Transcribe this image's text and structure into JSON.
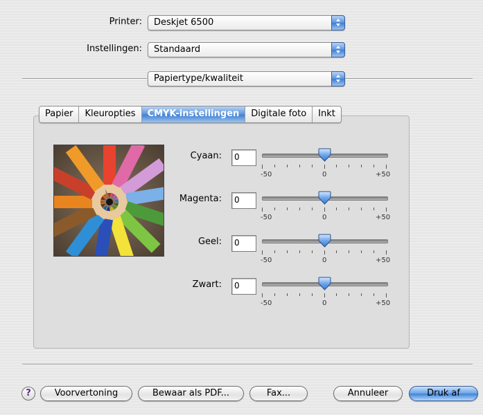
{
  "printer": {
    "label": "Printer:",
    "value": "Deskjet 6500"
  },
  "settings": {
    "label": "Instellingen:",
    "value": "Standaard"
  },
  "pane": {
    "value": "Papiertype/kwaliteit"
  },
  "tabs": [
    "Papier",
    "Kleuropties",
    "CMYK-instellingen",
    "Digitale foto",
    "Inkt"
  ],
  "active_tab": "CMYK-instellingen",
  "sliders": [
    {
      "label": "Cyaan:",
      "value": "0",
      "min": "-50",
      "mid": "0",
      "max": "+50",
      "level": 0
    },
    {
      "label": "Magenta:",
      "value": "0",
      "min": "-50",
      "mid": "0",
      "max": "+50",
      "level": 0
    },
    {
      "label": "Geel:",
      "value": "0",
      "min": "-50",
      "mid": "0",
      "max": "+50",
      "level": 0
    },
    {
      "label": "Zwart:",
      "value": "0",
      "min": "-50",
      "mid": "0",
      "max": "+50",
      "level": 0
    }
  ],
  "buttons": {
    "help": "?",
    "preview": "Voorvertoning",
    "save_pdf": "Bewaar als PDF...",
    "fax": "Fax...",
    "cancel": "Annuleer",
    "print": "Druk af"
  },
  "colors": {
    "accent": "#4a8ae0",
    "panel": "#dedede"
  },
  "icons": {
    "help": "help-icon",
    "popup": "popup-arrows-icon",
    "slider": "slider-thumb-icon"
  }
}
